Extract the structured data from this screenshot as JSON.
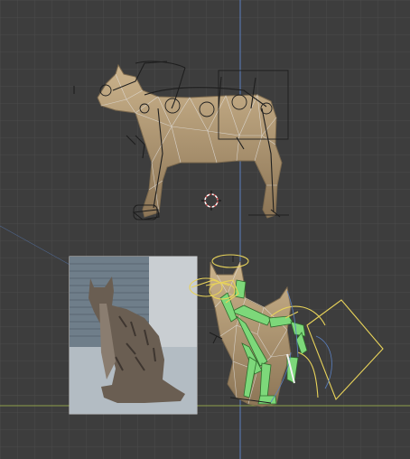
{
  "viewport": {
    "background": "#3d3d3d",
    "grid_color": "#4a4a4a",
    "axis_y_color": "#5a7fc0",
    "axis_x_color": "#8fa04a",
    "mesh_color": "#b9a07a",
    "mesh_shadow": "#7d6a4e",
    "wire_color": "#e6e6e6",
    "armature_color": "#7dd87a",
    "selection_color": "#e8d35a",
    "cursor_color": "#e05a5a",
    "empty_color": "#cccccc"
  },
  "objects": {
    "cat_side": "cat-side-mesh",
    "cat_sitting": "cat-sitting-mesh",
    "reference_photo": "reference-image",
    "cursor": "3d-cursor-icon",
    "armature": "armature-bones",
    "light": "light-icon"
  }
}
